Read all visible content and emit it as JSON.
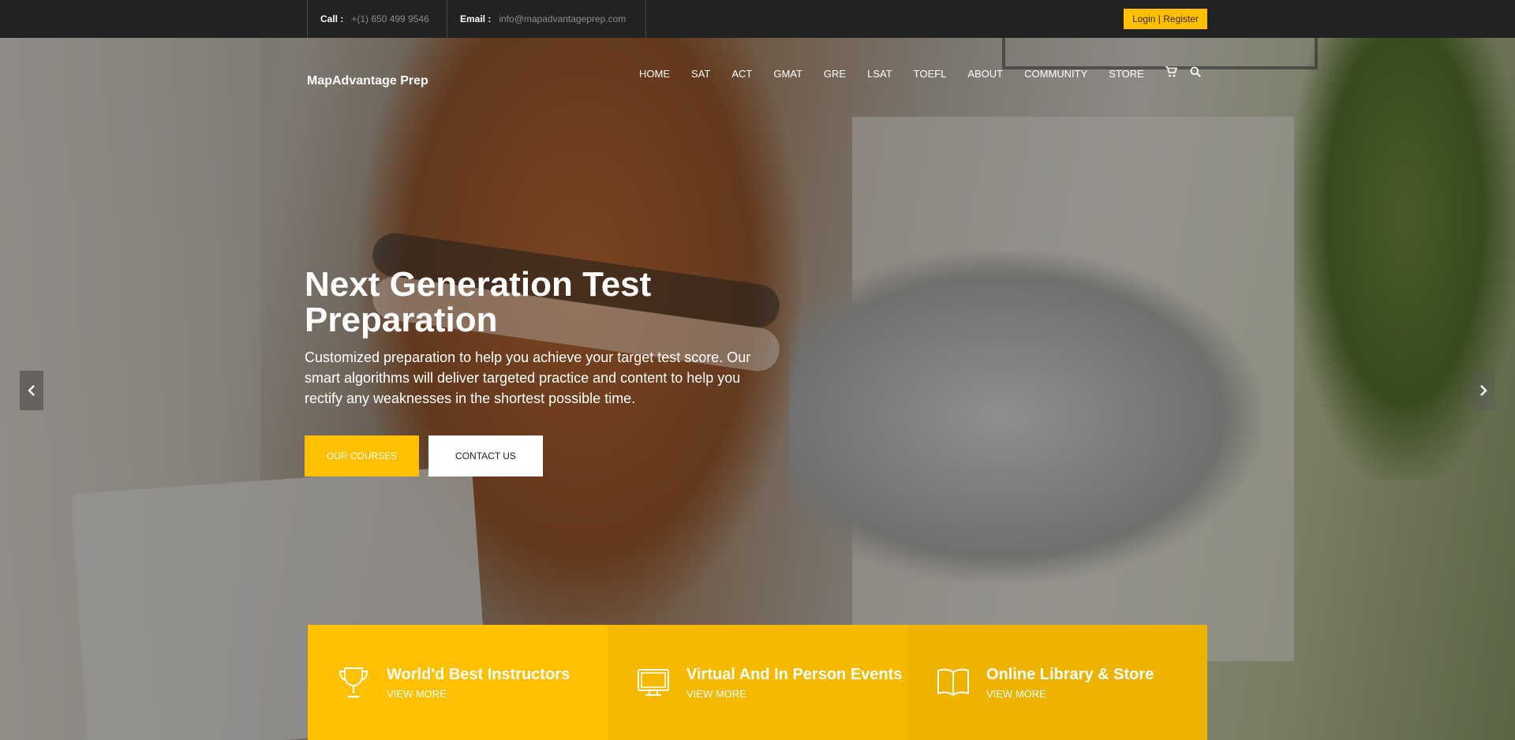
{
  "topbar": {
    "call_label": "Call :",
    "call_value": "+(1) 650 499 9546",
    "email_label": "Email :",
    "email_value": "info@mapadvantageprep.com",
    "login_label": "Login | Register"
  },
  "header": {
    "brand": "MapAdvantage Prep",
    "nav": [
      "HOME",
      "SAT",
      "ACT",
      "GMAT",
      "GRE",
      "LSAT",
      "TOEFL",
      "ABOUT",
      "COMMUNITY",
      "STORE"
    ],
    "icons": [
      "cart-icon",
      "search-icon"
    ]
  },
  "hero": {
    "title": "Next Generation Test Preparation",
    "subtitle": "Customized preparation to help you achieve your target test score. Our smart algorithms will deliver targeted practice and content to help you rectify any weaknesses in the shortest possible time.",
    "primary_button": "OUR COURSES",
    "secondary_button": "CONTACT US"
  },
  "features": [
    {
      "title": "World'd Best Instructors",
      "more": "VIEW MORE",
      "icon": "trophy-icon"
    },
    {
      "title": "Virtual And In Person Events",
      "more": "VIEW MORE",
      "icon": "monitor-icon"
    },
    {
      "title": "Online Library & Store",
      "more": "VIEW MORE",
      "icon": "book-icon"
    }
  ],
  "colors": {
    "accent": "#ffc000",
    "topbar": "#222222",
    "white": "#ffffff"
  }
}
